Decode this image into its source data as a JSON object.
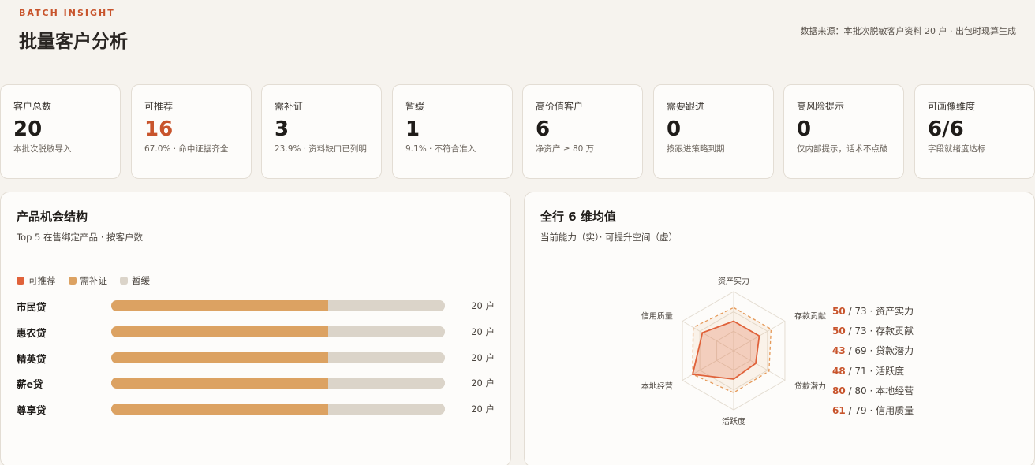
{
  "header": {
    "eyebrow": "BATCH INSIGHT",
    "title": "批量客户分析",
    "source": "数据来源：本批次脱敏客户资料 20 户 · 出包时现算生成"
  },
  "stats": [
    {
      "label": "客户总数",
      "value": "20",
      "note": "本批次脱敏导入"
    },
    {
      "label": "可推荐",
      "value": "16",
      "note": "67.0% · 命中证据齐全",
      "accent": true
    },
    {
      "label": "需补证",
      "value": "3",
      "note": "23.9% · 资料缺口已列明"
    },
    {
      "label": "暂缓",
      "value": "1",
      "note": "9.1% · 不符合准入"
    },
    {
      "label": "高价值客户",
      "value": "6",
      "note": "净资产 ≥ 80 万"
    },
    {
      "label": "需要跟进",
      "value": "0",
      "note": "按跟进策略到期"
    },
    {
      "label": "高风险提示",
      "value": "0",
      "note": "仅内部提示，话术不点破"
    },
    {
      "label": "可画像维度",
      "value": "6/6",
      "note": "字段就绪度达标"
    }
  ],
  "product": {
    "title": "产品机会结构",
    "subtitle": "Top 5 在售绑定产品 · 按客户数",
    "legend": [
      {
        "label": "可推荐",
        "color": "#e0623a"
      },
      {
        "label": "需补证",
        "color": "#dca262"
      },
      {
        "label": "暂缓",
        "color": "#dbd4c9"
      }
    ],
    "rows": [
      {
        "name": "市民贷",
        "count": "20 户",
        "recommend": 0,
        "supplement": 13,
        "pause": 7
      },
      {
        "name": "惠农贷",
        "count": "20 户",
        "recommend": 0,
        "supplement": 13,
        "pause": 7
      },
      {
        "name": "精英贷",
        "count": "20 户",
        "recommend": 0,
        "supplement": 13,
        "pause": 7
      },
      {
        "name": "薪e贷",
        "count": "20 户",
        "recommend": 0,
        "supplement": 13,
        "pause": 7
      },
      {
        "name": "尊享贷",
        "count": "20 户",
        "recommend": 0,
        "supplement": 13,
        "pause": 7
      }
    ]
  },
  "radar": {
    "title": "全行 6 维均值",
    "subtitle": "当前能力（实）· 可提升空间（虚）",
    "colors": {
      "current": "#e0623a",
      "potential": "#e59a5a"
    },
    "dimensions": [
      {
        "name": "资产实力",
        "current": 50,
        "max": 73
      },
      {
        "name": "存款贡献",
        "current": 50,
        "max": 73
      },
      {
        "name": "贷款潜力",
        "current": 43,
        "max": 69
      },
      {
        "name": "活跃度",
        "current": 48,
        "max": 71
      },
      {
        "name": "本地经营",
        "current": 80,
        "max": 80
      },
      {
        "name": "信用质量",
        "current": 61,
        "max": 79
      }
    ],
    "list": [
      {
        "cur": "50",
        "max": "/ 73",
        "label": " · 资产实力"
      },
      {
        "cur": "50",
        "max": "/ 73",
        "label": " · 存款贡献"
      },
      {
        "cur": "43",
        "max": "/ 69",
        "label": " · 贷款潜力"
      },
      {
        "cur": "48",
        "max": "/ 71",
        "label": " · 活跃度"
      },
      {
        "cur": "80",
        "max": "/ 80",
        "label": " · 本地经营"
      },
      {
        "cur": "61",
        "max": "/ 79",
        "label": " · 信用质量"
      }
    ]
  }
}
